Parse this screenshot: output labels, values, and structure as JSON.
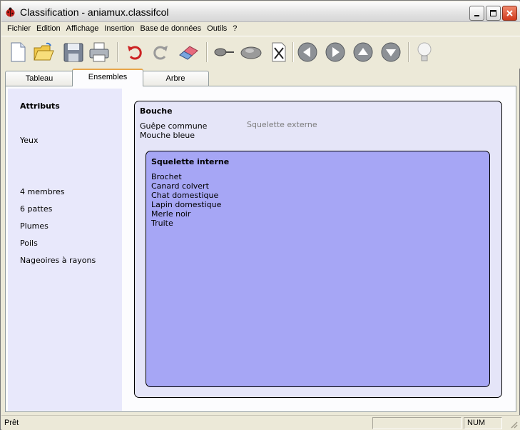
{
  "window": {
    "title": "Classification - aniamux.classifcol",
    "minimize_icon": "minimize-icon",
    "maximize_icon": "maximize-icon",
    "close_icon": "close-icon"
  },
  "menu": {
    "items": [
      "Fichier",
      "Edition",
      "Affichage",
      "Insertion",
      "Base de données",
      "Outils",
      "?"
    ]
  },
  "toolbar": {
    "buttons": [
      {
        "name": "new-document-icon"
      },
      {
        "name": "open-folder-icon"
      },
      {
        "name": "save-floppy-icon"
      },
      {
        "name": "print-icon"
      },
      {
        "name": "undo-icon"
      },
      {
        "name": "redo-icon"
      },
      {
        "name": "eraser-icon"
      },
      {
        "name": "pin-icon"
      },
      {
        "name": "stone-icon"
      },
      {
        "name": "delete-x-icon"
      },
      {
        "name": "arrow-left-icon"
      },
      {
        "name": "arrow-right-icon"
      },
      {
        "name": "arrow-up-icon"
      },
      {
        "name": "arrow-down-icon"
      },
      {
        "name": "lightbulb-icon"
      }
    ],
    "accent": "#cc2222"
  },
  "tabs": {
    "items": [
      "Tableau",
      "Ensembles",
      "Arbre"
    ],
    "active": "Ensembles"
  },
  "attributes": {
    "header": "Attributs",
    "items": [
      "Yeux",
      "4 membres",
      "6 pattes",
      "Plumes",
      "Poils",
      "Nageoires à rayons"
    ]
  },
  "sets": {
    "outer": {
      "title": "Bouche",
      "members": [
        "Guêpe commune",
        "Mouche bleue"
      ],
      "empty_set_label": "Squelette externe"
    },
    "inner": {
      "title": "Squelette interne",
      "members": [
        "Brochet",
        "Canard colvert",
        "Chat domestique",
        "Lapin domestique",
        "Merle noir",
        "Truite"
      ]
    },
    "colors": {
      "outer_fill": "#e5e5f8",
      "inner_fill": "#a6a6f5",
      "panel_fill": "#e8e8fb"
    }
  },
  "status": {
    "text": "Prêt",
    "mode": "NUM"
  }
}
